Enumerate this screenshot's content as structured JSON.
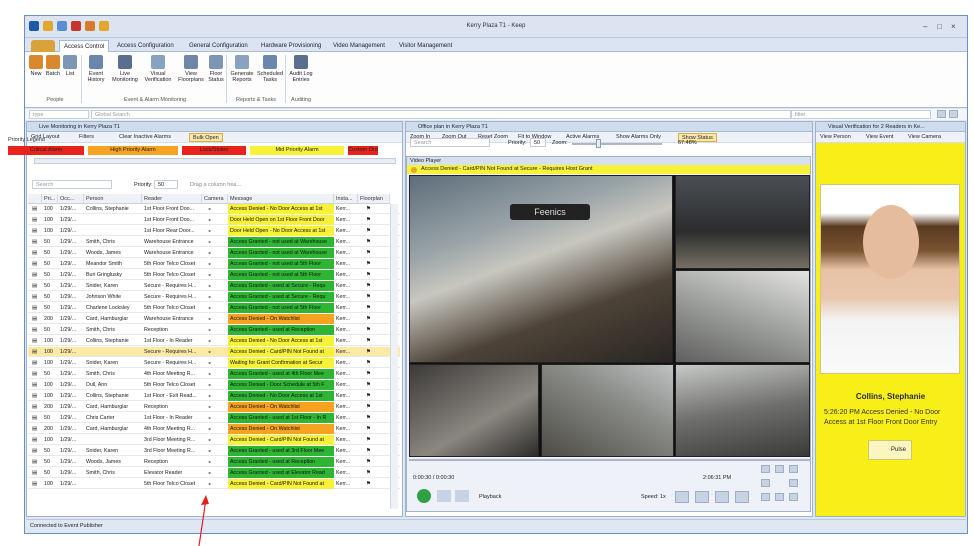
{
  "app": {
    "title": "Kerry Plaza T1 - Keep"
  },
  "tabs": [
    "Access Control",
    "Access Configuration",
    "General Configuration",
    "Hardware Provisioning",
    "Video Management",
    "Visitor Management"
  ],
  "ribbon": {
    "buttons": [
      {
        "label": "New",
        "icon": "new-person-icon"
      },
      {
        "label": "Batch",
        "icon": "batch-people-icon"
      },
      {
        "label": "List",
        "icon": "list-icon"
      },
      {
        "label": "Event History",
        "icon": "event-history-icon"
      },
      {
        "label": "Live Monitoring",
        "icon": "binoculars-icon"
      },
      {
        "label": "Visual Verification",
        "icon": "visual-verification-icon"
      },
      {
        "label": "View Floorplans",
        "icon": "floorplan-icon"
      },
      {
        "label": "Floor Status",
        "icon": "floor-status-icon"
      },
      {
        "label": "Generate Reports",
        "icon": "report-icon"
      },
      {
        "label": "Scheduled Tasks",
        "icon": "scheduled-task-icon"
      },
      {
        "label": "Audit Log Entries",
        "icon": "audit-log-icon"
      }
    ],
    "groups": [
      "People",
      "Event & Alarm Monitoring",
      "Reports & Tasks",
      "Auditing"
    ]
  },
  "search": {
    "type_placeholder": "type",
    "global_placeholder": "Global Search",
    "filter_placeholder": "filter"
  },
  "live": {
    "title": "Live Monitoring in Kerry Plaza T1",
    "toolbar": [
      "Grid Layout",
      "Filters",
      "Clear Inactive Alarms",
      "Bulk Open"
    ],
    "legend_title": "Priority Legend",
    "legend": [
      {
        "label": "Critical Alarm",
        "color": "#e8231c"
      },
      {
        "label": "High Priority Alarm",
        "color": "#f5a320"
      },
      {
        "label": "Lock/Stolen",
        "color": "#e8231c"
      },
      {
        "label": "Mid Priority Alarm",
        "color": "#f7f13a"
      },
      {
        "label": "Custom Ord",
        "color": "#e8231c"
      }
    ],
    "search_placeholder": "Search",
    "priority_label": "Priority:",
    "priority_value": "50",
    "drag_hint": "Drag a column hea...",
    "headers": [
      "Pri...",
      "Occ...",
      "Person",
      "Reader",
      "Camera",
      "Message",
      "Insta...",
      "Floorplan"
    ],
    "rows": [
      [
        "100",
        "1/29/...",
        "Collins, Stephanie",
        "1st Floor Front Doo...",
        "Access Denied - No Door Access at 1st",
        "Kerr..."
      ],
      [
        "100",
        "1/29/...",
        "",
        "1st Floor Front Doo...",
        "Door Held Open on 1st Floor Front Door",
        "Kerr..."
      ],
      [
        "100",
        "1/29/...",
        "",
        "1st Floor Rear Door...",
        "Door Held Open - No Door Access at 1st",
        "Kerr..."
      ],
      [
        "50",
        "1/29/...",
        "Smith, Chris",
        "Warehouse Entrance",
        "Access Granted - not used at Warehouse",
        "Kerr..."
      ],
      [
        "50",
        "1/29/...",
        "Woods, James",
        "Warehouse Entrance",
        "Access Granted - not used at Warehouse",
        "Kerr..."
      ],
      [
        "50",
        "1/29/...",
        "Meandor Smith",
        "5th Floor Telco Closet",
        "Access Granted - not used at 5th Floor",
        "Kerr..."
      ],
      [
        "50",
        "1/29/...",
        "Buri Gringlusky",
        "5th Floor Telco Closet",
        "Access Granted - not used at 5th Floor",
        "Kerr..."
      ],
      [
        "50",
        "1/29/...",
        "Snider, Karen",
        "Secure - Requires H...",
        "Access Granted - used at Secure - Requ",
        "Kerr..."
      ],
      [
        "50",
        "1/29/...",
        "Johnson White",
        "Secure - Requires H...",
        "Access Granted - used at Secure - Requ",
        "Kerr..."
      ],
      [
        "50",
        "1/29/...",
        "Charlene Locksley",
        "5th Floor Telco Closet",
        "Access Granted - not used at 5th Floor",
        "Kerr..."
      ],
      [
        "200",
        "1/29/...",
        "Card, Hamburglar",
        "Warehouse Entrance",
        "Access Denied - On Watchlist",
        "Kerr..."
      ],
      [
        "50",
        "1/29/...",
        "Smith, Chris",
        "Reception",
        "Access Granted - used at Reception",
        "Kerr..."
      ],
      [
        "100",
        "1/29/...",
        "Collins, Stephanie",
        "1st Floor - In Reader",
        "Access Denied - No Door Access at 1st",
        "Kerr..."
      ],
      [
        "100",
        "1/29/...",
        "",
        "Secure - Requires H...",
        "Access Denied - Card/PIN Not Found at",
        "Kerr..."
      ],
      [
        "100",
        "1/29/...",
        "Snider, Karen",
        "Secure - Requires H...",
        "Waiting for Grant Confirmation at Secur",
        "Kerr..."
      ],
      [
        "50",
        "1/29/...",
        "Smith, Chris",
        "4th Floor Meeting R...",
        "Access Granted - used at 4th Floor Mee",
        "Kerr..."
      ],
      [
        "100",
        "1/29/...",
        "Dull, Ann",
        "5th Floor Telco Closet",
        "Access Denied - Door Schedule at 5th F",
        "Kerr..."
      ],
      [
        "100",
        "1/29/...",
        "Collins, Stephanie",
        "1st Floor - Exit Read...",
        "Access Denied - No Door Access at 1st",
        "Kerr..."
      ],
      [
        "200",
        "1/29/...",
        "Card, Hamburglar",
        "Reception",
        "Access Denied - On Watchlist",
        "Kerr..."
      ],
      [
        "50",
        "1/29/...",
        "Chris Carter",
        "1st Floor - In Reader",
        "Access Granted - used at 1st Floor - In R",
        "Kerr..."
      ],
      [
        "200",
        "1/29/...",
        "Card, Hamburglar",
        "4th Floor Meeting R...",
        "Access Denied - On Watchlist",
        "Kerr..."
      ],
      [
        "100",
        "1/29/...",
        "",
        "3rd Floor Meeting R...",
        "Access Denied - Card/PIN Not Found at",
        "Kerr..."
      ],
      [
        "50",
        "1/29/...",
        "Snider, Karen",
        "3rd Floor Meeting R...",
        "Access Granted - used at 3rd Floor Mee",
        "Kerr..."
      ],
      [
        "50",
        "1/29/...",
        "Woods, James",
        "Reception",
        "Access Granted - used at Reception",
        "Kerr..."
      ],
      [
        "50",
        "1/29/...",
        "Smith, Chris",
        "Elevator Reader",
        "Access Granted - used at Elevator Read",
        "Kerr..."
      ],
      [
        "100",
        "1/29/...",
        "",
        "5th Floor Telco Closet",
        "Access Denied - Card/PIN Not Found at",
        "Kerr..."
      ]
    ],
    "row_colors": [
      "#f7f13a",
      "#f7f13a",
      "#f7f13a",
      "#2fb534",
      "#2fb534",
      "#2fb534",
      "#2fb534",
      "#2fb534",
      "#2fb534",
      "#2fb534",
      "#f5a320",
      "#2fb534",
      "#f7f13a",
      "#f7f13a",
      "#f7f13a",
      "#2fb534",
      "#2fb534",
      "#2fb534",
      "#f5a320",
      "#2fb534",
      "#f5a320",
      "#f7f13a",
      "#2fb534",
      "#2fb534",
      "#2fb534",
      "#f7f13a"
    ]
  },
  "floorplan": {
    "title": "Office plan  in Kerry Plaza T1",
    "toolbar": [
      "Zoom In",
      "Zoom Out",
      "Reset Zoom",
      "Fit to Window",
      "Active Alarms",
      "Show Alarms Only",
      "Show Status"
    ],
    "search_placeholder": "Search",
    "priority_label": "Priority:",
    "priority_value": "50",
    "zoom_label": "Zoom:",
    "zoom_value": "67.48%"
  },
  "player": {
    "title": "Video Player",
    "alarm_text": "Access Denied - Card/PIN Not Found at Secure - Requires Host Grant",
    "time_left": "0:00:30 / 0:00:30",
    "time_right": "2:06:31 PM",
    "playback_label": "Playback",
    "speed_label": "Speed: 1x"
  },
  "verify": {
    "title": "Visual Verification for 2 Readers in Ke...",
    "toolbar": [
      "View Person",
      "View Event",
      "View Camera"
    ],
    "person_name": "Collins, Stephanie",
    "event_text": "5:26:20 PM   Access Denied - No Door Access at 1st Floor Front Door Entry",
    "pulse_label": "Pulse"
  },
  "status": {
    "text": "Connected to Event Publisher"
  }
}
